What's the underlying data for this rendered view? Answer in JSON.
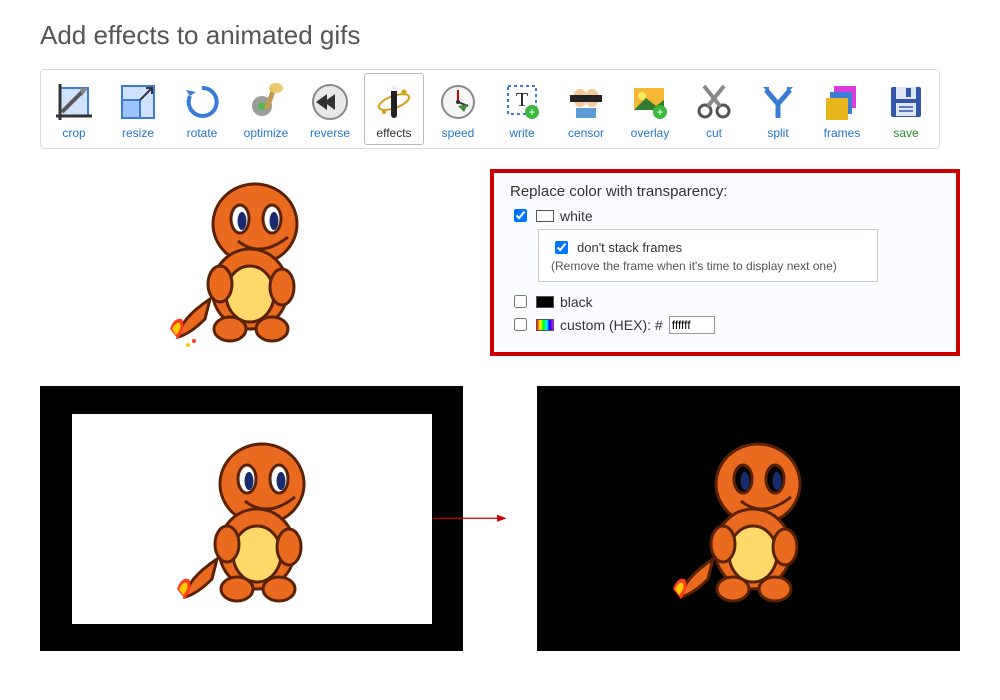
{
  "page": {
    "title": "Add effects to animated gifs"
  },
  "toolbar": {
    "items": [
      {
        "id": "crop",
        "label": "crop"
      },
      {
        "id": "resize",
        "label": "resize"
      },
      {
        "id": "rotate",
        "label": "rotate"
      },
      {
        "id": "optimize",
        "label": "optimize"
      },
      {
        "id": "reverse",
        "label": "reverse"
      },
      {
        "id": "effects",
        "label": "effects",
        "active": true
      },
      {
        "id": "speed",
        "label": "speed"
      },
      {
        "id": "write",
        "label": "write"
      },
      {
        "id": "censor",
        "label": "censor"
      },
      {
        "id": "overlay",
        "label": "overlay"
      },
      {
        "id": "cut",
        "label": "cut"
      },
      {
        "id": "split",
        "label": "split"
      },
      {
        "id": "frames",
        "label": "frames"
      },
      {
        "id": "save",
        "label": "save",
        "save": true
      }
    ]
  },
  "panel": {
    "title": "Replace color with transparency:",
    "white": {
      "label": "white",
      "checked": true
    },
    "dontStack": {
      "label": "don't stack frames",
      "hint": "(Remove the frame when it's time to display next one)",
      "checked": true
    },
    "black": {
      "label": "black",
      "checked": false
    },
    "custom": {
      "label": "custom (HEX): #",
      "value": "ffffff",
      "checked": false
    }
  }
}
